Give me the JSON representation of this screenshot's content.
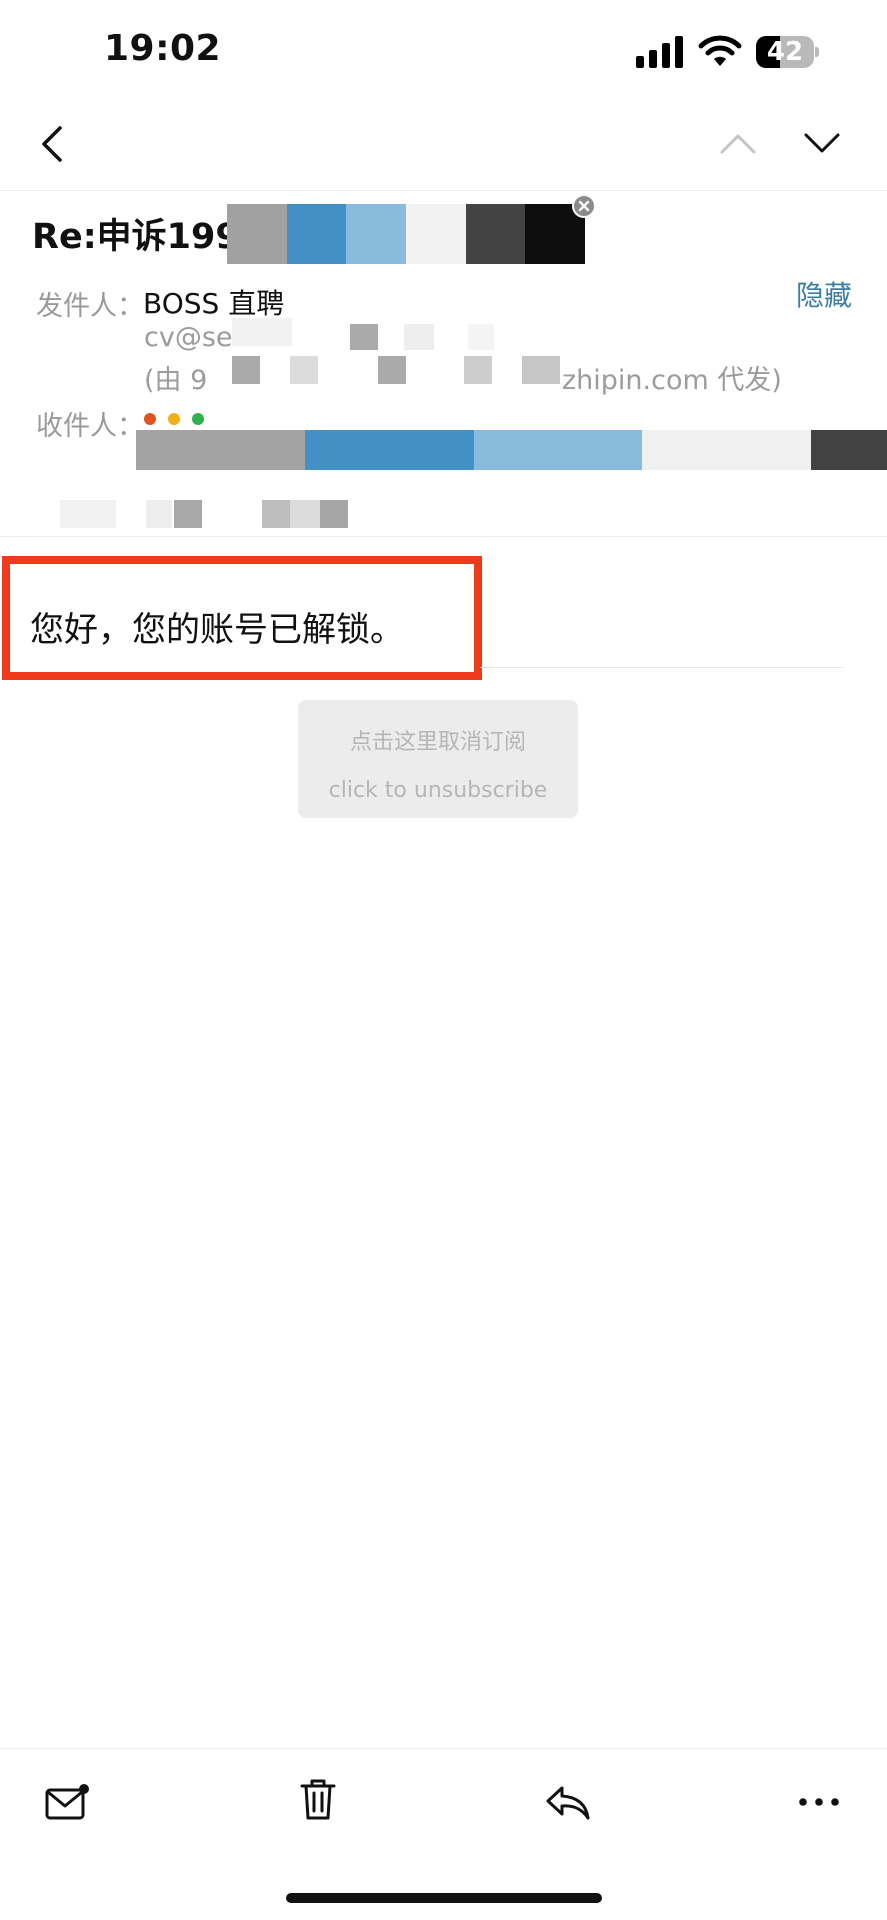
{
  "status_bar": {
    "time": "19:02",
    "battery_level": "42",
    "battery_fraction": 0.42
  },
  "nav": {
    "back_icon": "chevron-left-icon",
    "prev_icon": "chevron-up-icon",
    "next_icon": "chevron-down-icon"
  },
  "email": {
    "subject": "Re:申诉199",
    "hide_label": "隐藏",
    "from_label": "发件人：",
    "sender_name": "BOSS 直聘",
    "sender_email_partial": "cv@se",
    "sent_on_behalf_prefix": "(由 9",
    "sent_on_behalf_suffix": "zhipin.com 代发)",
    "to_label": "收件人：",
    "body_text": "您好，您的账号已解锁。",
    "unsubscribe_cn": "点击这里取消订阅",
    "unsubscribe_en": "click to unsubscribe"
  },
  "colors": {
    "highlight_border": "#ef3b1c",
    "link": "#3c7ea3",
    "dot_red": "#e2541d",
    "dot_yellow": "#f0b018",
    "dot_green": "#2db34a"
  },
  "toolbar": {
    "mark_icon": "mail-unread-icon",
    "delete_icon": "trash-icon",
    "reply_icon": "reply-icon",
    "more_icon": "more-horizontal-icon"
  }
}
